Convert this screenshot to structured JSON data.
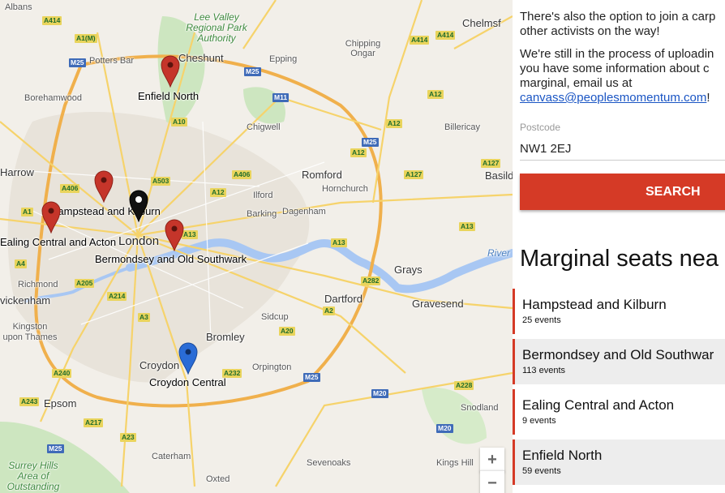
{
  "sidebar": {
    "para1": "There's also the option to join a carp",
    "para1b": "other activists on the way!",
    "para2": "We're still in the process of uploadin",
    "para2b": "you have some information about c",
    "para2c_prefix": "marginal, email us at",
    "email": "canvass@peoplesmomentum.com",
    "email_suffix": "!",
    "postcode_label": "Postcode",
    "postcode_value": "NW1 2EJ",
    "search_label": "SEARCH",
    "list_heading": "Marginal seats nea",
    "seats": [
      {
        "name": "Hampstead and Kilburn",
        "events": "25 events"
      },
      {
        "name": "Bermondsey and Old Southwar",
        "events": "113 events"
      },
      {
        "name": "Ealing Central and Acton",
        "events": "9 events"
      },
      {
        "name": "Enfield North",
        "events": "59 events"
      }
    ]
  },
  "map": {
    "constituencies": [
      "Enfield North",
      "Hampstead and Kilburn",
      "Ealing Central and Acton",
      "Bermondsey and Old Southwark",
      "Croydon Central"
    ],
    "places": [
      "Albans",
      "Cheshunt",
      "Potters Bar",
      "Borehamwood",
      "Epping",
      "Chipping Ongar",
      "Chelmsf",
      "Billericay",
      "Chigwell",
      "Harrow",
      "Romford",
      "Hornchurch",
      "Ilford",
      "Barking",
      "Dagenham",
      "Basild",
      "London",
      "Richmond",
      "vickenham",
      "Kingston upon Thames",
      "Grays",
      "Dartford",
      "Gravesend",
      "Sidcup",
      "Bromley",
      "Croydon",
      "Orpington",
      "Epsom",
      "Caterham",
      "Sevenoaks",
      "Kings Hill",
      "Oxted",
      "Snodland",
      "River"
    ],
    "parks": [
      "Lee Valley Regional Park Authority",
      "Surrey Hills Area of Outstanding"
    ],
    "roads": [
      "A414",
      "A1(M)",
      "M25",
      "A10",
      "M11",
      "A12",
      "A406",
      "A503",
      "A127",
      "A13",
      "A4",
      "A205",
      "A214",
      "A3",
      "A282",
      "A2",
      "A20",
      "A232",
      "A240",
      "A243",
      "A217",
      "A23",
      "M20",
      "A228",
      "A1"
    ],
    "pin_colors": {
      "marginal": "#c5352a",
      "selected": "#2a6cd6",
      "home": "#111111"
    },
    "zoom_in": "+",
    "zoom_out": "−"
  }
}
